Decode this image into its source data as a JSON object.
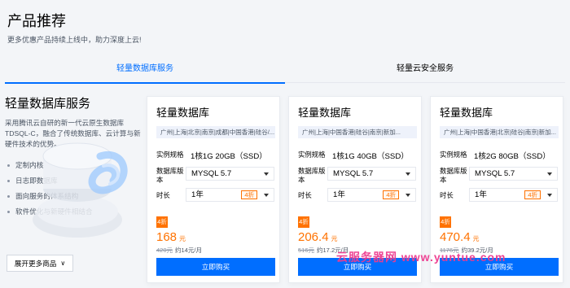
{
  "header": {
    "title": "产品推荐",
    "subtitle": "更多优惠产品持续上线中，助力深度上云!"
  },
  "tabs": [
    {
      "label": "轻量数据库服务",
      "active": true
    },
    {
      "label": "轻量云安全服务",
      "active": false
    }
  ],
  "intro": {
    "title": "轻量数据库服务",
    "description": "采用腾讯云自研的新一代云原生数据库TDSQL-C，融合了传统数据库、云计算与新硬件技术的优势。",
    "features": [
      "定制内核",
      "日志即数据库",
      "面向服务的体系结构",
      "软件优化与新硬件相结合"
    ],
    "more_label": "展开更多商品"
  },
  "labels": {
    "spec": "实例规格",
    "version": "数据库版本",
    "duration": "时长"
  },
  "cards": [
    {
      "title": "轻量数据库",
      "region": "广州|上海|北京|南京|成都|中国香港|硅谷/...",
      "spec": "1核1G 20GB（SSD）",
      "version": "MYSQL 5.7",
      "duration": "1年",
      "discount": "4折",
      "price": "168",
      "unit": "元",
      "original": "420元",
      "monthly": "约14元/月",
      "buy_label": "立即购买"
    },
    {
      "title": "轻量数据库",
      "region": "广州|上海|中国香港|硅谷|南京|新加...",
      "spec": "1核1G 40GB（SSD）",
      "version": "MYSQL 5.7",
      "duration": "1年",
      "discount": "4折",
      "price": "206.4",
      "unit": "元",
      "original": "516元",
      "monthly": "约17.2元/月",
      "buy_label": "立即购买"
    },
    {
      "title": "轻量数据库",
      "region": "广州|上海|中国香港|北京|硅谷|南京|新加...",
      "spec": "1核2G 80GB（SSD）",
      "version": "MYSQL 5.7",
      "duration": "1年",
      "discount": "4折",
      "price": "470.4",
      "unit": "元",
      "original": "1176元",
      "monthly": "约39.2元/月",
      "buy_label": "立即购买"
    }
  ],
  "watermark": "云服务器网 www.yuntue.com",
  "colors": {
    "accent": "#006eff",
    "price": "#ff7200",
    "watermark": "#ee3b8f"
  }
}
